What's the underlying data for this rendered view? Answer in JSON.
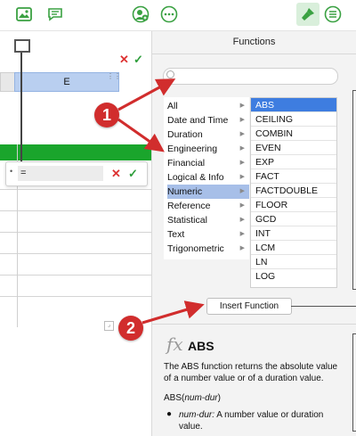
{
  "sheet": {
    "column_label": "E",
    "formula_text": "=",
    "cell_ref_dot": "•"
  },
  "panel": {
    "title": "Functions",
    "search_placeholder": "",
    "categories": [
      {
        "label": "All"
      },
      {
        "label": "Date and Time"
      },
      {
        "label": "Duration"
      },
      {
        "label": "Engineering"
      },
      {
        "label": "Financial"
      },
      {
        "label": "Logical & Info"
      },
      {
        "label": "Numeric"
      },
      {
        "label": "Reference"
      },
      {
        "label": "Statistical"
      },
      {
        "label": "Text"
      },
      {
        "label": "Trigonometric"
      }
    ],
    "selected_category": "Numeric",
    "functions": [
      {
        "label": "ABS"
      },
      {
        "label": "CEILING"
      },
      {
        "label": "COMBIN"
      },
      {
        "label": "EVEN"
      },
      {
        "label": "EXP"
      },
      {
        "label": "FACT"
      },
      {
        "label": "FACTDOUBLE"
      },
      {
        "label": "FLOOR"
      },
      {
        "label": "GCD"
      },
      {
        "label": "INT"
      },
      {
        "label": "LCM"
      },
      {
        "label": "LN"
      },
      {
        "label": "LOG"
      }
    ],
    "selected_function": "ABS",
    "insert_button": "Insert Function",
    "fx_symbol": "fx",
    "desc_title": "ABS",
    "desc_text": "The ABS function returns the absolute value of a number value or of a duration value.",
    "syntax_name": "ABS(",
    "syntax_arg": "num-dur",
    "syntax_close": ")",
    "arg_bullet": "●",
    "arg_name": "num-dur:",
    "arg_desc": " A number value or duration value."
  },
  "callouts": {
    "one": "1",
    "two": "2"
  },
  "colors": {
    "accent_green": "#3aa142",
    "header_green": "#1aa52c",
    "selection_blue": "#3e7de0",
    "callout_red": "#d12d2d"
  },
  "icons": [
    "image-icon",
    "comment-icon",
    "add-person-icon",
    "more-icon",
    "format-brush-icon",
    "menu-icon",
    "close-icon",
    "check-icon",
    "chevron-right-icon",
    "search-icon",
    "function-fx-icon"
  ]
}
